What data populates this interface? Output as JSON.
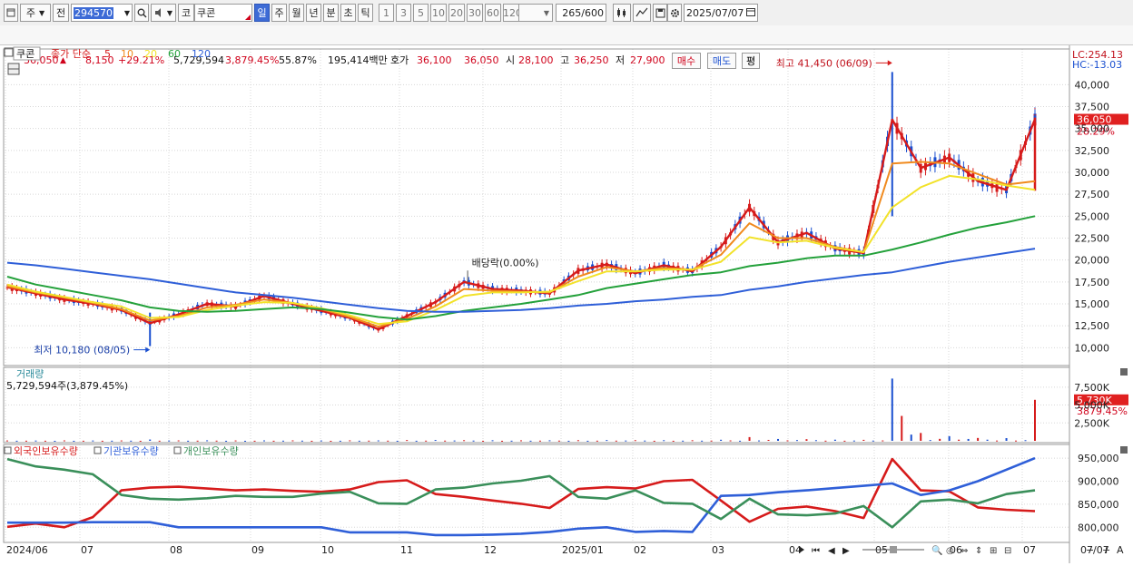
{
  "toolbar": {
    "period_type": "주",
    "prev_label": "전",
    "stock_code": "294570",
    "code_prefix": "코",
    "stock_name": "쿠콘",
    "period_buttons": [
      "일",
      "주",
      "월",
      "년",
      "분",
      "초",
      "틱"
    ],
    "interval_buttons": [
      "1",
      "3",
      "5",
      "10",
      "20",
      "30",
      "60",
      "120"
    ],
    "count_value": "265",
    "count_total": "/600",
    "date_value": "2025/07/07"
  },
  "quote": {
    "price": "36,050",
    "change": "8,150",
    "change_pct": "+29.21%",
    "volume": "5,729,594",
    "volume_pct": "3,879.45%",
    "turnover_pct": "55.87%",
    "amount": "195,414백만",
    "ask_label": "호가",
    "ask_price": "36,100",
    "bid_price": "36,050",
    "open_label": "시",
    "open_price": "28,100",
    "high_label": "고",
    "high_price": "36,250",
    "low_label": "저",
    "low_price": "27,900",
    "buy_label": "매수",
    "sell_label": "매도",
    "eval_label": "평"
  },
  "price_panel": {
    "name_label": "쿠콘",
    "ma_label": "종가 단순",
    "ma_periods": [
      "5",
      "10",
      "20",
      "60",
      "120"
    ],
    "ma_colors": [
      "#d61b1b",
      "#f08a1e",
      "#f2e22a",
      "#24a13b",
      "#2f5fd8"
    ],
    "lc_text": "LC:254.13",
    "hc_text": "HC:-13.03",
    "high_annotation": "최고 41,450 (06/09)",
    "low_annotation": "최저 10,180 (08/05)",
    "dividend_annotation": "배당락(0.00%)",
    "current_price_tag": "36,050",
    "current_pct_tag": "28.29%",
    "y_ticks": [
      "40,000",
      "37,500",
      "35,000",
      "32,500",
      "30,000",
      "27,500",
      "25,000",
      "22,500",
      "20,000",
      "17,500",
      "15,000",
      "12,500",
      "10,000"
    ]
  },
  "volume_panel": {
    "label": "거래량",
    "value_text": "5,729,594주(3,879.45%)",
    "y_ticks": [
      "7,500K",
      "5,000K",
      "2,500K"
    ],
    "current_tag": "5,730K",
    "current_pct_tag": "3879.45%"
  },
  "holdings_panel": {
    "labels": [
      "외국인보유수량",
      "기관보유수량",
      "개인보유수량"
    ],
    "colors": [
      "#d61b1b",
      "#2f5fd8",
      "#3a8f5a"
    ],
    "y_ticks": [
      "950,000",
      "900,000",
      "850,000",
      "800,000"
    ]
  },
  "x_axis": {
    "labels": [
      "2024/06",
      "07",
      "08",
      "09",
      "10",
      "11",
      "12",
      "2025/01",
      "02",
      "03",
      "04",
      "05",
      "06",
      "07"
    ],
    "right_label": "07/07"
  },
  "chart_data": [
    {
      "type": "line",
      "title": "",
      "series": [
        {
          "name": "5",
          "values": [
            16900,
            16200,
            15500,
            15000,
            14300,
            12800,
            13800,
            15000,
            14700,
            15900,
            15000,
            14200,
            13400,
            12100,
            13600,
            15200,
            17500,
            16700,
            16500,
            16200,
            18800,
            19500,
            18500,
            19400,
            18700,
            21500,
            26000,
            22000,
            23100,
            21300,
            20800,
            36000,
            30500,
            31700,
            29000,
            28000,
            36050
          ]
        },
        {
          "name": "10",
          "values": [
            17000,
            16300,
            15700,
            15100,
            14400,
            13100,
            13600,
            14600,
            14900,
            15500,
            15100,
            14400,
            13500,
            12400,
            13300,
            14700,
            16700,
            16500,
            16400,
            16300,
            18100,
            19200,
            18700,
            19100,
            18900,
            20600,
            24200,
            22500,
            22500,
            21500,
            20900,
            31000,
            31200,
            31000,
            29800,
            28600,
            29000
          ]
        },
        {
          "name": "20",
          "values": [
            17200,
            16400,
            15800,
            15200,
            14700,
            13400,
            13500,
            14300,
            14800,
            15200,
            15100,
            14500,
            13700,
            12700,
            13000,
            14300,
            15900,
            16300,
            16300,
            16400,
            17600,
            18700,
            18700,
            18900,
            18900,
            19800,
            22600,
            22000,
            22200,
            21400,
            20900,
            26000,
            28300,
            29600,
            29200,
            28500,
            28000
          ]
        },
        {
          "name": "60",
          "values": [
            18100,
            17200,
            16600,
            16000,
            15400,
            14600,
            14200,
            14100,
            14200,
            14400,
            14600,
            14400,
            14000,
            13500,
            13200,
            13600,
            14200,
            14600,
            15000,
            15500,
            16000,
            16800,
            17300,
            17800,
            18300,
            18600,
            19300,
            19700,
            20200,
            20500,
            20500,
            21200,
            22000,
            22900,
            23700,
            24300,
            25000
          ]
        },
        {
          "name": "120",
          "values": [
            19700,
            19400,
            19000,
            18600,
            18200,
            17800,
            17300,
            16800,
            16300,
            16000,
            15700,
            15300,
            14900,
            14500,
            14200,
            14100,
            14100,
            14200,
            14300,
            14500,
            14800,
            15000,
            15300,
            15500,
            15800,
            16000,
            16600,
            17000,
            17500,
            17900,
            18300,
            18600,
            19200,
            19800,
            20300,
            20800,
            21300
          ]
        }
      ],
      "ylim": [
        9000,
        42000
      ],
      "high": 41450,
      "low": 10180,
      "last_close": 36050
    },
    {
      "type": "bar",
      "title": "",
      "values": [
        50,
        40,
        60,
        45,
        55,
        180,
        60,
        70,
        55,
        60,
        65,
        50,
        70,
        60,
        110,
        120,
        90,
        80,
        70,
        75,
        90,
        110,
        95,
        90,
        85,
        150,
        520,
        260,
        230,
        160,
        140,
        8700,
        1100,
        650,
        400,
        380,
        5730
      ],
      "ylim": [
        0,
        9000
      ],
      "unit": "K"
    },
    {
      "type": "line",
      "title": "",
      "series": [
        {
          "name": "외국인보유수량",
          "values": [
            801000,
            808000,
            800000,
            822000,
            880000,
            886000,
            888000,
            884000,
            880000,
            882000,
            879000,
            877000,
            882000,
            898000,
            902000,
            872000,
            866000,
            858000,
            851000,
            842000,
            883000,
            887000,
            884000,
            900000,
            903000,
            858000,
            812000,
            840000,
            845000,
            835000,
            820000,
            948000,
            880000,
            878000,
            843000,
            838000,
            835000
          ]
        },
        {
          "name": "기관보유수량",
          "values": [
            810000,
            810000,
            810000,
            811000,
            811000,
            811000,
            800000,
            800000,
            800000,
            800000,
            800000,
            800000,
            789000,
            789000,
            789000,
            783000,
            783000,
            784000,
            786000,
            790000,
            797000,
            800000,
            790000,
            792000,
            790000,
            868000,
            870000,
            876000,
            880000,
            885000,
            890000,
            895000,
            870000,
            880000,
            900000,
            925000,
            950000
          ]
        },
        {
          "name": "개인보유수량",
          "values": [
            948000,
            932000,
            925000,
            915000,
            870000,
            862000,
            860000,
            863000,
            868000,
            866000,
            866000,
            873000,
            877000,
            852000,
            851000,
            882000,
            886000,
            895000,
            901000,
            911000,
            866000,
            862000,
            880000,
            853000,
            851000,
            818000,
            862000,
            828000,
            826000,
            830000,
            846000,
            800000,
            856000,
            860000,
            852000,
            872000,
            880000
          ]
        }
      ],
      "ylim": [
        775000,
        960000
      ]
    }
  ]
}
